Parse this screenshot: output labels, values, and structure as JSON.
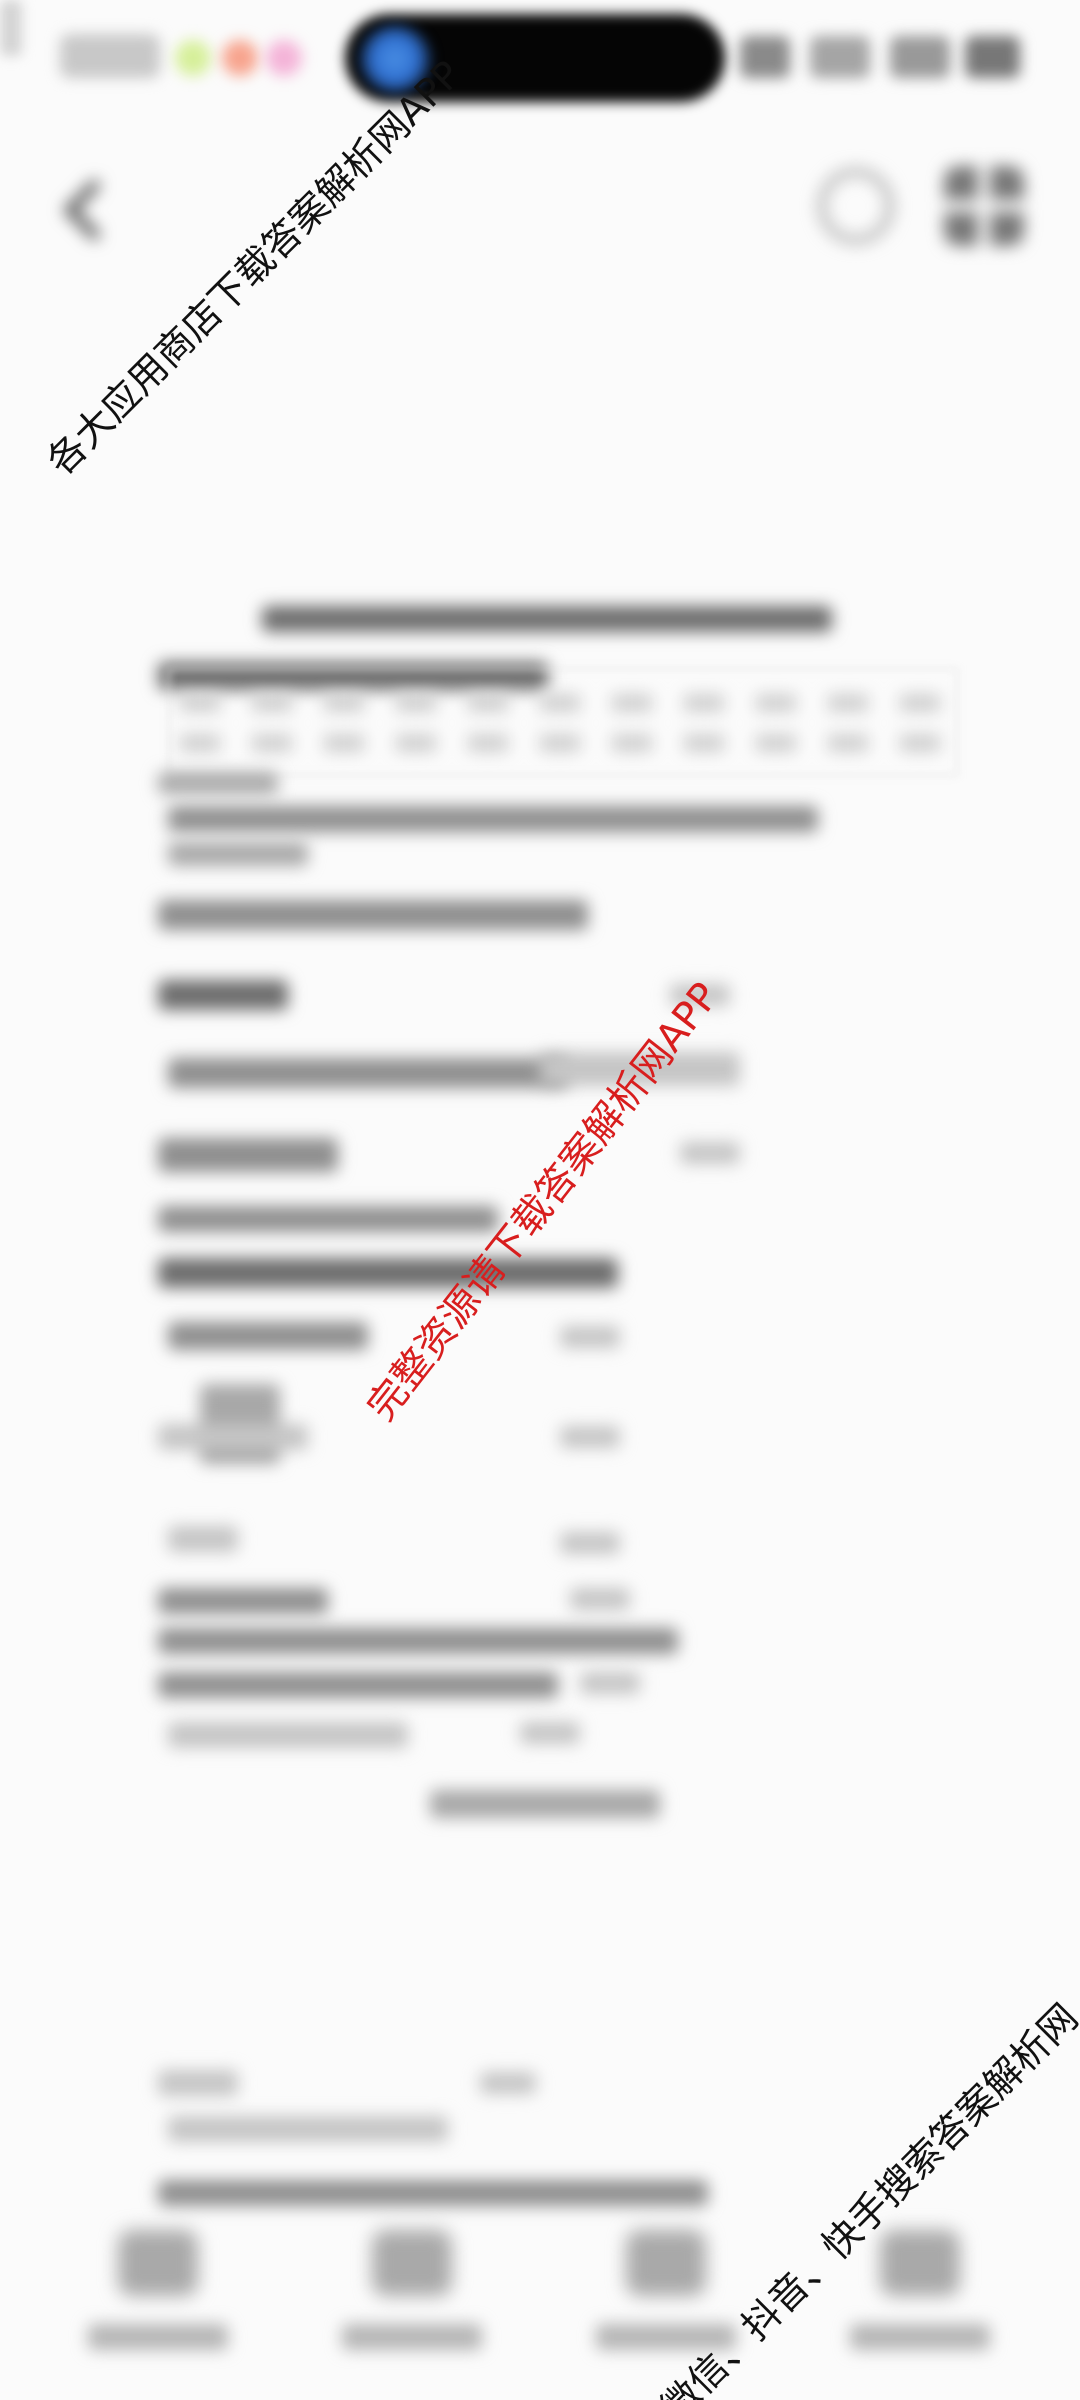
{
  "watermarks": {
    "top_left": "各大应用商店下载答案解析网APP",
    "center": "完整资源请下载答案解析网APP",
    "bottom_right": "微信、抖音、快手搜索答案解析网"
  },
  "status_bar": {
    "island_accent_color": "#3b82f6"
  },
  "header": {
    "back_icon": "back-arrow-icon",
    "history_icon": "clock-icon",
    "apps_icon": "grid-icon",
    "more_icon": "more-icon"
  },
  "bottom_nav": {
    "items": [
      {
        "icon": "home-icon"
      },
      {
        "icon": "document-icon"
      },
      {
        "icon": "grid-icon"
      },
      {
        "icon": "apps-icon"
      }
    ]
  },
  "colors": {
    "background": "#fbfbfb",
    "watermark_red": "#d81e1e",
    "watermark_black": "#111111"
  }
}
